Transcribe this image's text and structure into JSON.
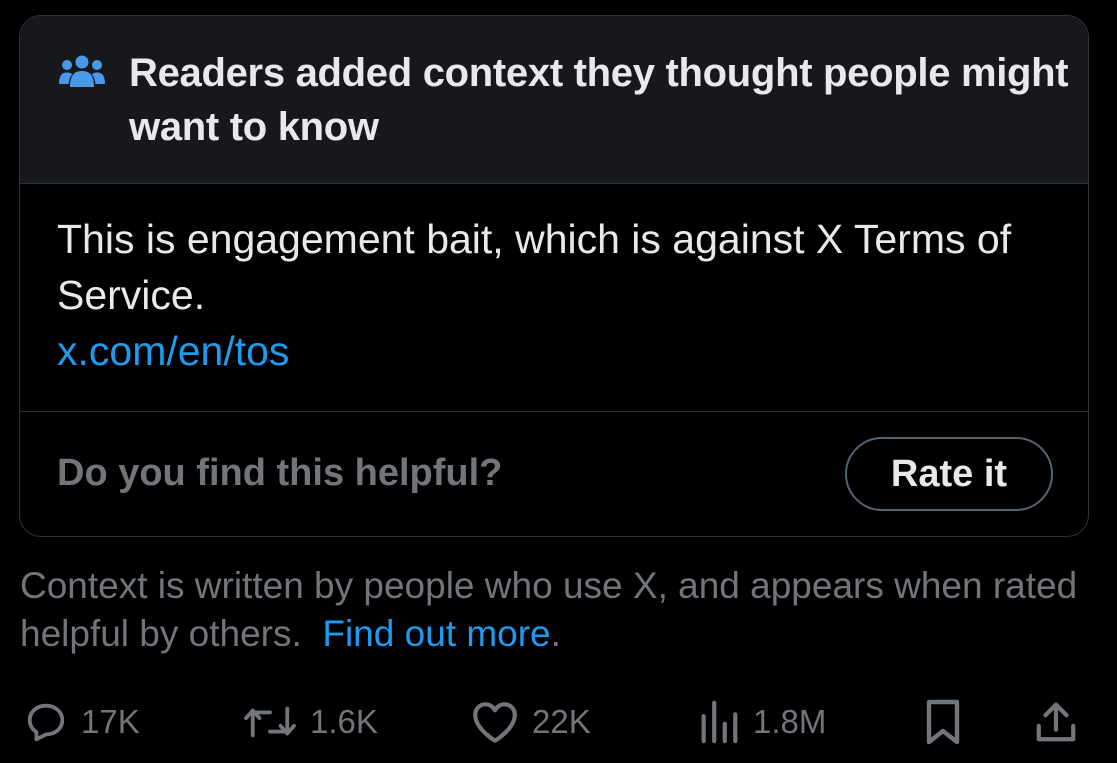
{
  "note": {
    "header_title": "Readers added context they thought people might want to know",
    "header_icon": "people-group-icon",
    "body_text": "This is engagement bait, which is against X Terms of Service.",
    "link_text": "x.com/en/tos",
    "helpful_question": "Do you find this helpful?",
    "rate_button_label": "Rate it"
  },
  "disclaimer": {
    "text": "Context is written by people who use X, and appears when rated helpful by others.",
    "link_text": "Find out more",
    "link_suffix": "."
  },
  "actions": {
    "replies": {
      "icon": "reply-icon",
      "count": "17K"
    },
    "reposts": {
      "icon": "repost-icon",
      "count": "1.6K"
    },
    "likes": {
      "icon": "heart-icon",
      "count": "22K"
    },
    "views": {
      "icon": "views-icon",
      "count": "1.8M"
    },
    "bookmark": {
      "icon": "bookmark-icon"
    },
    "share": {
      "icon": "share-icon"
    }
  },
  "colors": {
    "background": "#000000",
    "header_background": "#16181c",
    "border": "#2f3336",
    "primary_text": "#e7e9ea",
    "secondary_text": "#71767b",
    "link": "#1d9bf0"
  }
}
